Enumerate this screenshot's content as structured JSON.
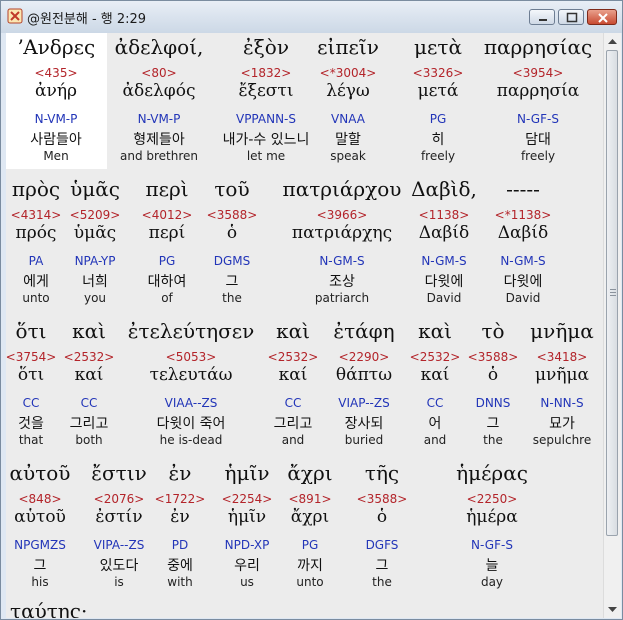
{
  "window": {
    "title": "@원전분해 - 행 2:29",
    "minimize_label": "",
    "maximize_label": "",
    "close_label": ""
  },
  "colors": {
    "strong_number": "#b3242a",
    "morphology": "#2235b8",
    "selection": "#ffffff",
    "background": "#ececec"
  },
  "rows": [
    {
      "words": [
        {
          "greek": "ʼΑνδρες",
          "strong": "<435>",
          "lemma": "ἀνήρ",
          "morph": "N-VM-P",
          "korean": "사람들아",
          "english": "Men"
        },
        {
          "greek": "ἀδελφοί,",
          "strong": "<80>",
          "lemma": "ἀδελφός",
          "morph": "N-VM-P",
          "korean": "형제들아",
          "english": "and brethren"
        },
        {
          "greek": "ἐξὸν",
          "strong": "<1832>",
          "lemma": "ἔξεστι",
          "morph": "VPPANN-S",
          "korean": "내가-수 있느니",
          "english": "let me"
        },
        {
          "greek": "εἰπεῖν",
          "strong": "<*3004>",
          "lemma": "λέγω",
          "morph": "VNAA",
          "korean": "말할",
          "english": "speak"
        },
        {
          "greek": "μετὰ",
          "strong": "<3326>",
          "lemma": "μετά",
          "morph": "PG",
          "korean": "히",
          "english": "freely"
        },
        {
          "greek": "παρρησίας",
          "strong": "<3954>",
          "lemma": "παρρησία",
          "morph": "N-GF-S",
          "korean": "담대",
          "english": "freely"
        }
      ]
    },
    {
      "words": [
        {
          "greek": "πρὸς",
          "strong": "<4314>",
          "lemma": "πρός",
          "morph": "PA",
          "korean": "에게",
          "english": "unto"
        },
        {
          "greek": "ὑμᾶς",
          "strong": "<5209>",
          "lemma": "ὑμᾶς",
          "morph": "NPA-YP",
          "korean": "너희",
          "english": "you"
        },
        {
          "greek": "περὶ",
          "strong": "<4012>",
          "lemma": "περί",
          "morph": "PG",
          "korean": "대하여",
          "english": "of"
        },
        {
          "greek": "τοῦ",
          "strong": "<3588>",
          "lemma": "ὁ",
          "morph": "DGMS",
          "korean": "그",
          "english": "the"
        },
        {
          "greek": "πατριάρχου",
          "strong": "<3966>",
          "lemma": "πατριάρχης",
          "morph": "N-GM-S",
          "korean": "조상",
          "english": "patriarch"
        },
        {
          "greek": "Δαβὶδ,",
          "strong": "<1138>",
          "lemma": "Δαβίδ",
          "morph": "N-GM-S",
          "korean": "다윗에",
          "english": "David"
        },
        {
          "greek": "-----",
          "strong": "<*1138>",
          "lemma": "Δαβίδ",
          "morph": "N-GM-S",
          "korean": "다윗에",
          "english": "David"
        }
      ]
    },
    {
      "words": [
        {
          "greek": "ὅτι",
          "strong": "<3754>",
          "lemma": "ὅτι",
          "morph": "CC",
          "korean": "것을",
          "english": "that"
        },
        {
          "greek": "καὶ",
          "strong": "<2532>",
          "lemma": "καί",
          "morph": "CC",
          "korean": "그리고",
          "english": "both"
        },
        {
          "greek": "ἐτελεύτησεν",
          "strong": "<5053>",
          "lemma": "τελευτάω",
          "morph": "VIAA--ZS",
          "korean": "다윗이 죽어",
          "english": "he is-dead"
        },
        {
          "greek": "καὶ",
          "strong": "<2532>",
          "lemma": "καί",
          "morph": "CC",
          "korean": "그리고",
          "english": "and"
        },
        {
          "greek": "ἐτάφη",
          "strong": "<2290>",
          "lemma": "θάπτω",
          "morph": "VIAP--ZS",
          "korean": "장사되",
          "english": "buried"
        },
        {
          "greek": "καὶ",
          "strong": "<2532>",
          "lemma": "καί",
          "morph": "CC",
          "korean": "어",
          "english": "and"
        },
        {
          "greek": "τὸ",
          "strong": "<3588>",
          "lemma": "ὁ",
          "morph": "DNNS",
          "korean": "그",
          "english": "the"
        },
        {
          "greek": "μνῆμα",
          "strong": "<3418>",
          "lemma": "μνῆμα",
          "morph": "N-NN-S",
          "korean": "묘가",
          "english": "sepulchre"
        }
      ]
    },
    {
      "words": [
        {
          "greek": "αὐτοῦ",
          "strong": "<848>",
          "lemma": "αὑτοῦ",
          "morph": "NPGMZS",
          "korean": "그",
          "english": "his"
        },
        {
          "greek": "ἔστιν",
          "strong": "<2076>",
          "lemma": "ἐστίν",
          "morph": "VIPA--ZS",
          "korean": "있도다",
          "english": "is"
        },
        {
          "greek": "ἐν",
          "strong": "<1722>",
          "lemma": "ἐν",
          "morph": "PD",
          "korean": "중에",
          "english": "with"
        },
        {
          "greek": "ἡμῖν",
          "strong": "<2254>",
          "lemma": "ἡμῖν",
          "morph": "NPD-XP",
          "korean": "우리",
          "english": "us"
        },
        {
          "greek": "ἄχρι",
          "strong": "<891>",
          "lemma": "ἄχρι",
          "morph": "PG",
          "korean": "까지",
          "english": "unto"
        },
        {
          "greek": "τῆς",
          "strong": "<3588>",
          "lemma": "ὁ",
          "morph": "DGFS",
          "korean": "그",
          "english": "the"
        },
        {
          "greek": "ἡμέρας",
          "strong": "<2250>",
          "lemma": "ἡμέρα",
          "morph": "N-GF-S",
          "korean": "늘",
          "english": "day"
        }
      ]
    }
  ],
  "next_line_partial": "ταύτης·"
}
